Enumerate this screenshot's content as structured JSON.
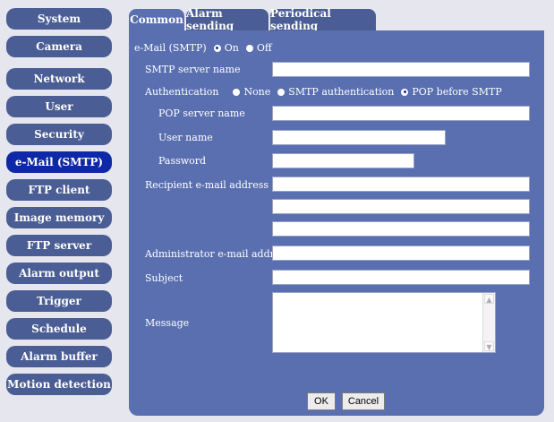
{
  "sidebar": {
    "items": [
      {
        "label": "System",
        "active": false
      },
      {
        "label": "Camera",
        "active": false
      },
      {
        "label": "Network",
        "active": false
      },
      {
        "label": "User",
        "active": false
      },
      {
        "label": "Security",
        "active": false
      },
      {
        "label": "e-Mail (SMTP)",
        "active": true
      },
      {
        "label": "FTP client",
        "active": false
      },
      {
        "label": "Image memory",
        "active": false
      },
      {
        "label": "FTP server",
        "active": false
      },
      {
        "label": "Alarm output",
        "active": false
      },
      {
        "label": "Trigger",
        "active": false
      },
      {
        "label": "Schedule",
        "active": false
      },
      {
        "label": "Alarm buffer",
        "active": false
      },
      {
        "label": "Motion detection",
        "active": false
      }
    ]
  },
  "tabs": [
    {
      "label": "Common",
      "active": true
    },
    {
      "label": "Alarm sending",
      "active": false
    },
    {
      "label": "Periodical sending",
      "active": false
    }
  ],
  "form": {
    "email_smtp": {
      "label": "e-Mail (SMTP)",
      "options": [
        {
          "label": "On",
          "selected": true
        },
        {
          "label": "Off",
          "selected": false
        }
      ]
    },
    "smtp_server_name": {
      "label": "SMTP server name",
      "value": ""
    },
    "authentication": {
      "label": "Authentication",
      "options": [
        {
          "label": "None",
          "selected": false
        },
        {
          "label": "SMTP authentication",
          "selected": false
        },
        {
          "label": "POP before SMTP",
          "selected": true
        }
      ]
    },
    "pop_server_name": {
      "label": "POP server name",
      "value": ""
    },
    "user_name": {
      "label": "User name",
      "value": ""
    },
    "password": {
      "label": "Password",
      "value": ""
    },
    "recipient": {
      "label": "Recipient e-mail address",
      "values": [
        "",
        "",
        ""
      ]
    },
    "administrator": {
      "label": "Administrator e-mail address",
      "value": ""
    },
    "subject": {
      "label": "Subject",
      "value": ""
    },
    "message": {
      "label": "Message",
      "value": ""
    }
  },
  "buttons": {
    "ok": "OK",
    "cancel": "Cancel"
  },
  "colors": {
    "nav_bg": "#4a5d94",
    "nav_active": "#0f28a8",
    "panel_bg": "#5a6fb0",
    "page_bg": "#e6e6ee"
  }
}
